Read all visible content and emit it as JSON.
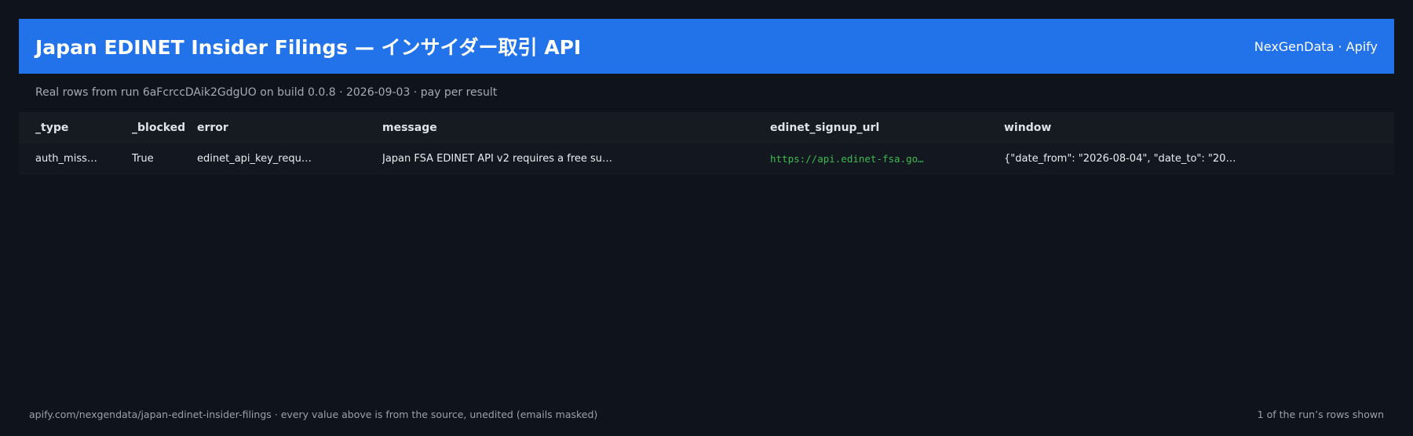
{
  "header": {
    "title": "Japan EDINET Insider Filings — インサイダー取引 API",
    "brand": "NexGenData · Apify"
  },
  "subtitle": "Real rows from run 6aFcrccDAik2GdgUO on build 0.0.8 · 2026-09-03 · pay per result",
  "table": {
    "columns": [
      "_type",
      "_blocked",
      "error",
      "message",
      "edinet_signup_url",
      "window"
    ],
    "rows": [
      [
        "auth_miss…",
        "True",
        "edinet_api_key_requ…",
        "Japan FSA EDINET API v2 requires a free su…",
        "https://api.edinet-fsa.go…",
        "{\"date_from\": \"2026-08-04\", \"date_to\": \"20…"
      ]
    ]
  },
  "footer": {
    "left": "apify.com/nexgendata/japan-edinet-insider-filings  ·  every value above is from the source, unedited (emails masked)",
    "right": "1 of the run’s rows shown"
  },
  "colors": {
    "background": "#0f131c",
    "header": "#2272e9",
    "link": "#3fb950"
  }
}
